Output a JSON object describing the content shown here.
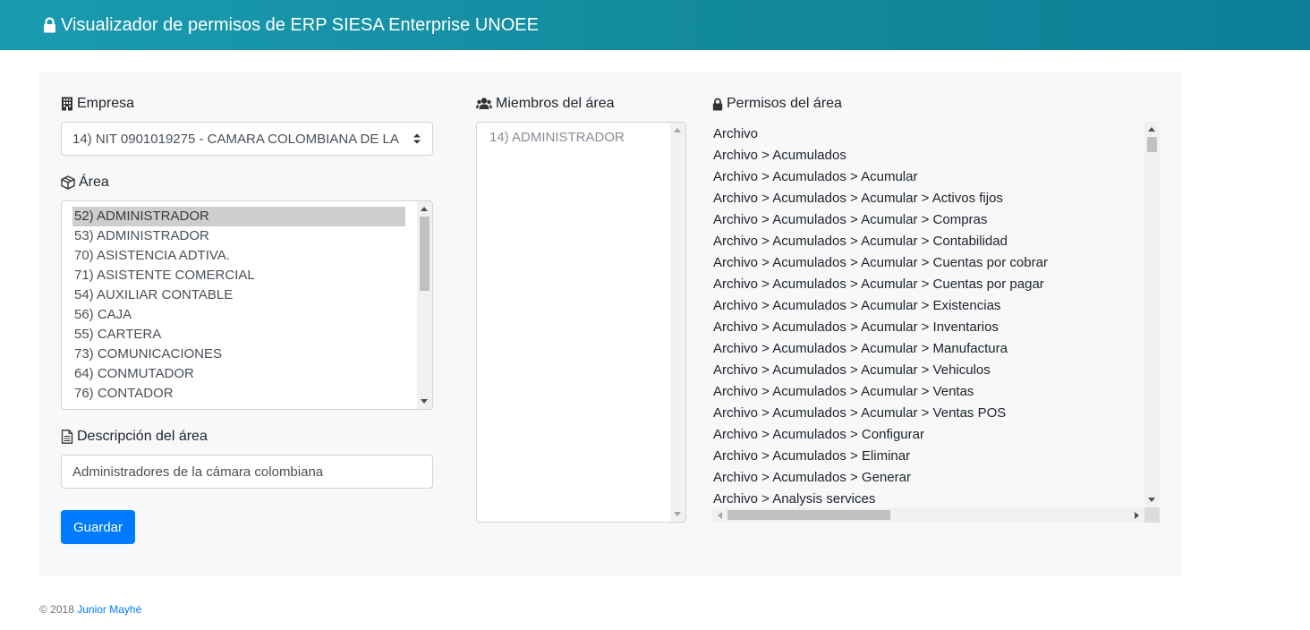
{
  "header": {
    "title": "Visualizador de permisos de ERP SIESA Enterprise UNOEE",
    "icon": "lock-icon"
  },
  "empresa": {
    "label": "Empresa",
    "icon": "building-icon",
    "selected": "14) NIT 0901019275 - CAMARA COLOMBIANA DE LA"
  },
  "area": {
    "label": "Área",
    "icon": "cube-icon",
    "items": [
      "52) ADMINISTRADOR",
      "53) ADMINISTRADOR",
      "70) ASISTENCIA ADTIVA.",
      "71) ASISTENTE COMERCIAL",
      "54) AUXILIAR CONTABLE",
      "56) CAJA",
      "55) CARTERA",
      "73) COMUNICACIONES",
      "64) CONMUTADOR",
      "76) CONTADOR"
    ],
    "selected_index": 0
  },
  "descripcion": {
    "label": "Descripción del área",
    "icon": "file-text-icon",
    "value": "Administradores de la cámara colombiana"
  },
  "save_button": {
    "label": "Guardar",
    "color": "#007bff"
  },
  "miembros": {
    "label": "Miembros del área",
    "icon": "users-icon",
    "items": [
      "14) ADMINISTRADOR"
    ]
  },
  "permisos": {
    "label": "Permisos del área",
    "icon": "lock-icon",
    "items": [
      "Archivo",
      "Archivo > Acumulados",
      "Archivo > Acumulados > Acumular",
      "Archivo > Acumulados > Acumular > Activos fijos",
      "Archivo > Acumulados > Acumular > Compras",
      "Archivo > Acumulados > Acumular > Contabilidad",
      "Archivo > Acumulados > Acumular > Cuentas por cobrar",
      "Archivo > Acumulados > Acumular > Cuentas por pagar",
      "Archivo > Acumulados > Acumular > Existencias",
      "Archivo > Acumulados > Acumular > Inventarios",
      "Archivo > Acumulados > Acumular > Manufactura",
      "Archivo > Acumulados > Acumular > Vehiculos",
      "Archivo > Acumulados > Acumular > Ventas",
      "Archivo > Acumulados > Acumular > Ventas POS",
      "Archivo > Acumulados > Configurar",
      "Archivo > Acumulados > Eliminar",
      "Archivo > Acumulados > Generar",
      "Archivo > Analysis services"
    ]
  },
  "footer": {
    "copyright": "© 2018",
    "author": "Junior Mayhé"
  },
  "colors": {
    "header_start": "#1a9bb0",
    "header_end": "#0c7f96",
    "primary": "#007bff",
    "panel_bg": "#f7f8f9"
  }
}
